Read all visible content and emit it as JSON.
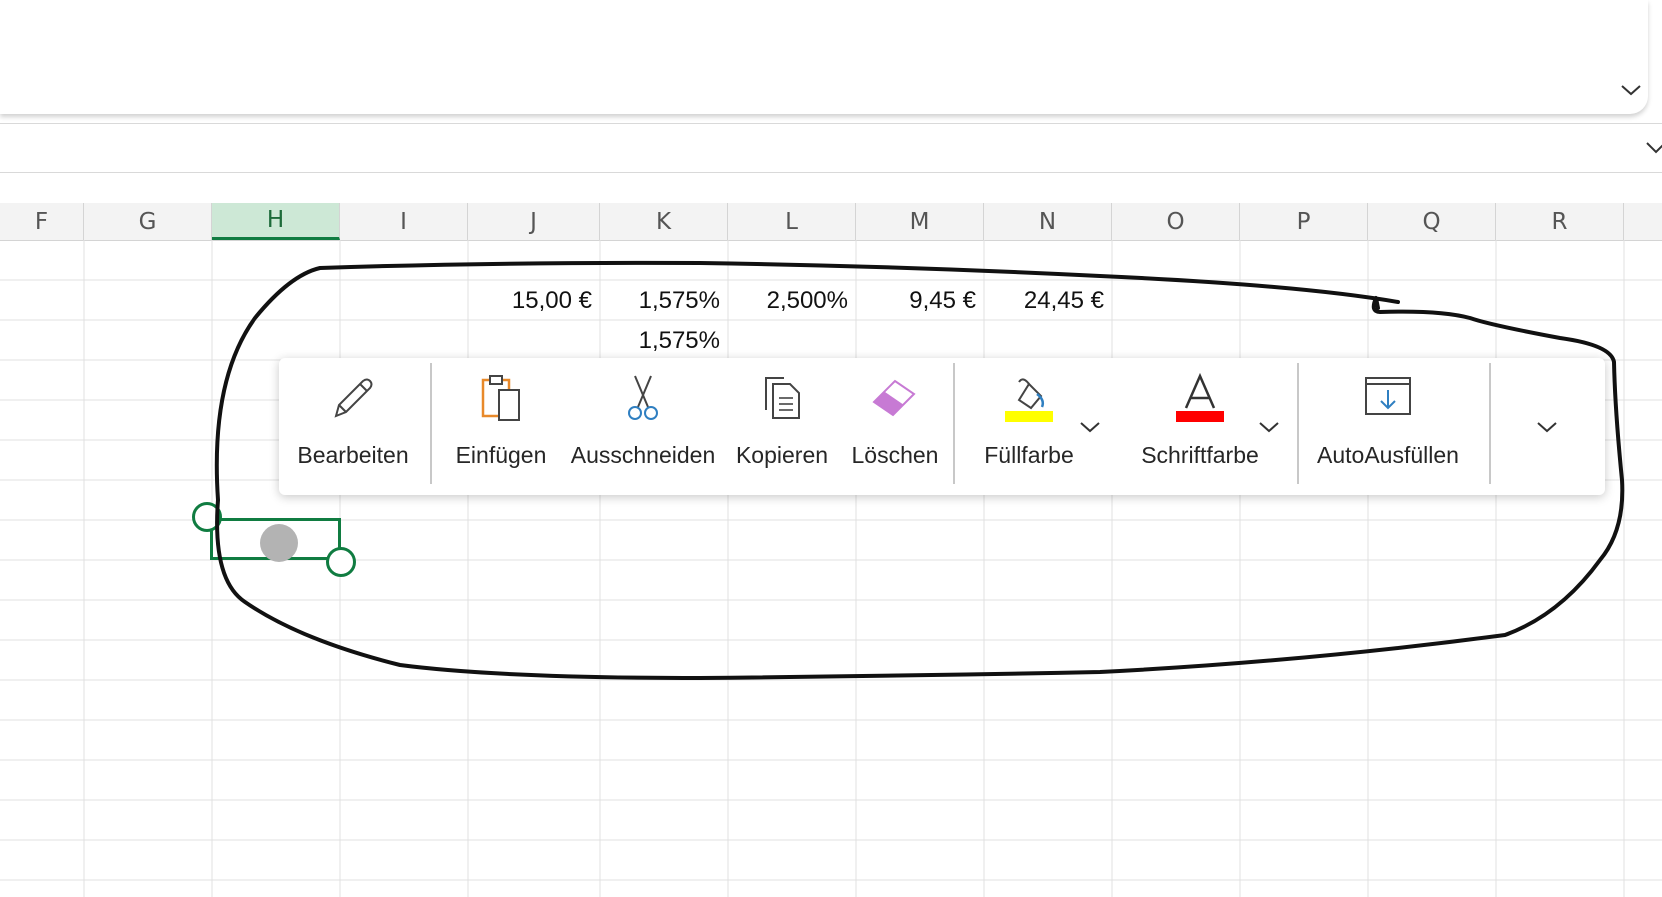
{
  "columns": [
    {
      "label": "F",
      "selected": false
    },
    {
      "label": "G",
      "selected": false
    },
    {
      "label": "H",
      "selected": true
    },
    {
      "label": "I",
      "selected": false
    },
    {
      "label": "J",
      "selected": false
    },
    {
      "label": "K",
      "selected": false
    },
    {
      "label": "L",
      "selected": false
    },
    {
      "label": "M",
      "selected": false
    },
    {
      "label": "N",
      "selected": false
    },
    {
      "label": "O",
      "selected": false
    },
    {
      "label": "P",
      "selected": false
    },
    {
      "label": "Q",
      "selected": false
    },
    {
      "label": "R",
      "selected": false
    }
  ],
  "cells": {
    "row1": {
      "J": "15,00 €",
      "K": "1,575%",
      "L": "2,500%",
      "M": "9,45 €",
      "N": "24,45 €"
    },
    "row2": {
      "K": "1,575%"
    }
  },
  "context_menu": {
    "edit_label": "Bearbeiten",
    "paste_label": "Einfügen",
    "cut_label": "Ausschneiden",
    "copy_label": "Kopieren",
    "clear_label": "Löschen",
    "fill_color_label": "Füllfarbe",
    "font_color_label": "Schriftfarbe",
    "autofill_label": "AutoAusfüllen"
  },
  "icons": {
    "edit": "pencil-icon",
    "paste": "clipboard-icon",
    "cut": "scissors-icon",
    "copy": "copy-icon",
    "clear": "eraser-icon",
    "fill_color": "paint-bucket-icon",
    "font_color": "font-color-icon",
    "autofill": "autofill-icon",
    "more": "chevron-down-icon"
  },
  "colors": {
    "accent_green": "#107c41",
    "fill_color_swatch": "#ffff00",
    "font_color_swatch": "#ff0000",
    "clear_icon": "#c77ad4",
    "paste_icon": "#e8892a",
    "cut_icon": "#2f7fc1"
  }
}
